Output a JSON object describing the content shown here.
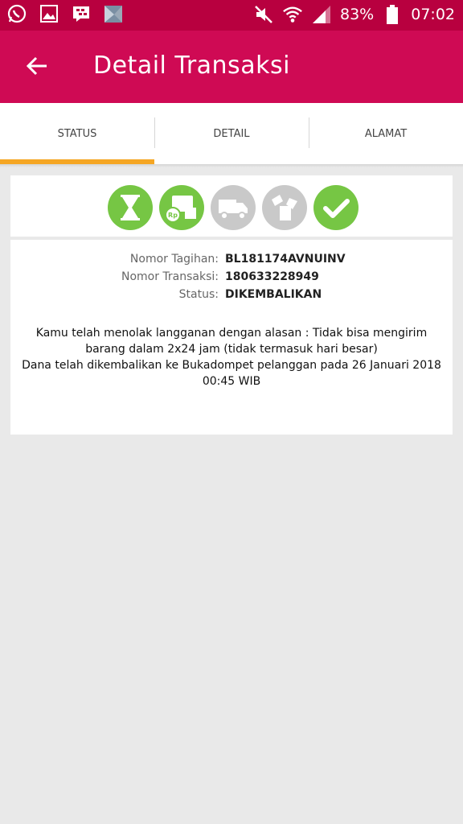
{
  "status_bar": {
    "battery": "83%",
    "time": "07:02",
    "icons": [
      "whatsapp-icon",
      "gallery-icon",
      "bbm-icon",
      "app-icon",
      "mute-icon",
      "wifi-icon",
      "signal-icon",
      "battery-icon"
    ]
  },
  "app_bar": {
    "title": "Detail Transaksi",
    "back_icon": "arrow-left-icon"
  },
  "tabs": [
    {
      "label": "STATUS",
      "active": true
    },
    {
      "label": "DETAIL",
      "active": false
    },
    {
      "label": "ALAMAT",
      "active": false
    }
  ],
  "steps": [
    {
      "icon": "hourglass-icon",
      "state": "done"
    },
    {
      "icon": "payment-icon",
      "state": "done"
    },
    {
      "icon": "truck-icon",
      "state": "inactive"
    },
    {
      "icon": "package-icon",
      "state": "inactive"
    },
    {
      "icon": "checkmark-icon",
      "state": "done"
    }
  ],
  "colors": {
    "status_bar": "#b8003f",
    "app_bar": "#cf0a54",
    "tab_indicator": "#f5a623",
    "step_done": "#76c644",
    "step_inactive": "#c9c9c9"
  },
  "transaction": {
    "invoice_label": "Nomor Tagihan:",
    "invoice_value": "BL181174AVNUINV",
    "transaction_label": "Nomor Transaksi:",
    "transaction_value": "180633228949",
    "status_label": "Status:",
    "status_value": "DIKEMBALIKAN"
  },
  "messages": {
    "rejection": "Kamu telah menolak langganan dengan alasan : Tidak bisa mengirim barang dalam 2x24 jam (tidak termasuk hari besar)",
    "refund": "Dana telah dikembalikan ke Bukadompet pelanggan pada 26 Januari 2018 00:45 WIB"
  }
}
